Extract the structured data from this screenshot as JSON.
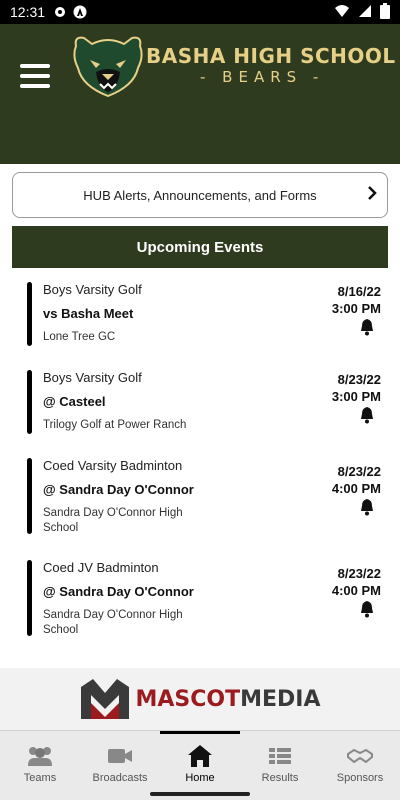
{
  "status": {
    "time": "12:31"
  },
  "header": {
    "school_name": "BASHA HIGH SCHOOL",
    "school_sub": "- BEARS -"
  },
  "hub": {
    "label": "HUB Alerts, Announcements, and Forms"
  },
  "events_title": "Upcoming Events",
  "events": [
    {
      "team": "Boys Varsity Golf",
      "opponent": "vs Basha Meet",
      "location": "Lone Tree GC",
      "date": "8/16/22",
      "time": "3:00 PM"
    },
    {
      "team": "Boys Varsity Golf",
      "opponent": "@ Casteel",
      "location": "Trilogy Golf at Power Ranch",
      "date": "8/23/22",
      "time": "3:00 PM"
    },
    {
      "team": "Coed Varsity Badminton",
      "opponent": "@ Sandra Day O'Connor",
      "location": "Sandra Day O'Connor High School",
      "date": "8/23/22",
      "time": "4:00 PM"
    },
    {
      "team": "Coed JV Badminton",
      "opponent": "@ Sandra Day O'Connor",
      "location": "Sandra Day O'Connor High School",
      "date": "8/23/22",
      "time": "4:00 PM"
    }
  ],
  "sponsor": {
    "mascot": "MASCOT",
    "media": "MEDIA"
  },
  "tabs": [
    {
      "label": "Teams",
      "icon": "teams-icon"
    },
    {
      "label": "Broadcasts",
      "icon": "video-icon"
    },
    {
      "label": "Home",
      "icon": "home-icon"
    },
    {
      "label": "Results",
      "icon": "list-icon"
    },
    {
      "label": "Sponsors",
      "icon": "handshake-icon"
    }
  ],
  "active_tab": "Home",
  "colors": {
    "brand_green": "#2f3b1e",
    "gold": "#e6cf86",
    "sponsor_red": "#9b1b1e"
  }
}
